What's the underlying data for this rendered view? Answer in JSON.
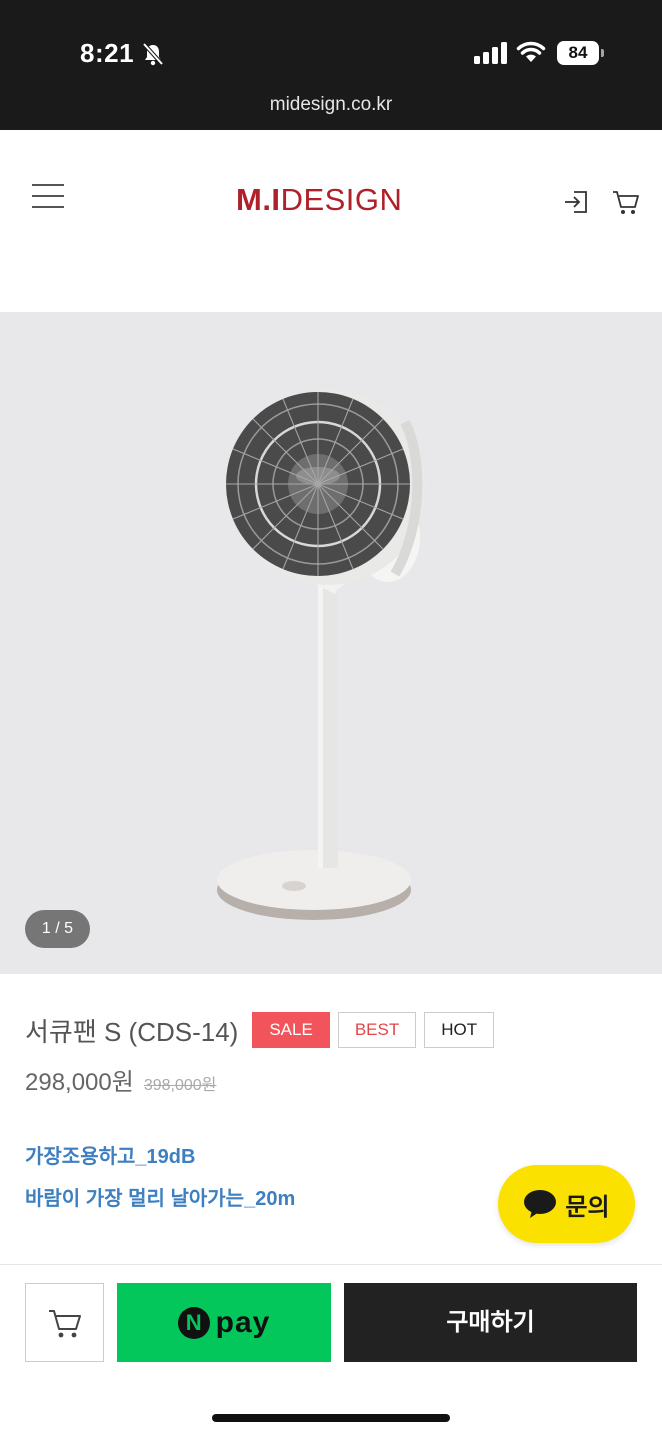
{
  "status_bar": {
    "time": "8:21",
    "battery": "84",
    "url": "midesign.co.kr"
  },
  "header": {
    "logo_prefix": "M.I",
    "logo_suffix": "DESIGN",
    "brand_color": "#b0202a",
    "icons": [
      "menu-icon",
      "login-icon",
      "cart-icon"
    ]
  },
  "gallery": {
    "counter": "1 / 5",
    "background": "#e8e8ea"
  },
  "product": {
    "name": "서큐팬 S (CDS-14)",
    "badges": {
      "sale": "SALE",
      "best": "BEST",
      "hot": "HOT"
    },
    "price": "298,000원",
    "original_price": "398,000원",
    "features": [
      "가장조용하고_19dB",
      "바람이 가장 멀리 날아가는_20m"
    ],
    "feature_color": "#3d7fc0"
  },
  "inquiry_button": {
    "label": "문의",
    "color": "#fae100"
  },
  "bottom_bar": {
    "npay_label": "pay",
    "npay_mark": "N",
    "npay_color": "#03c75a",
    "buy_label": "구매하기"
  }
}
